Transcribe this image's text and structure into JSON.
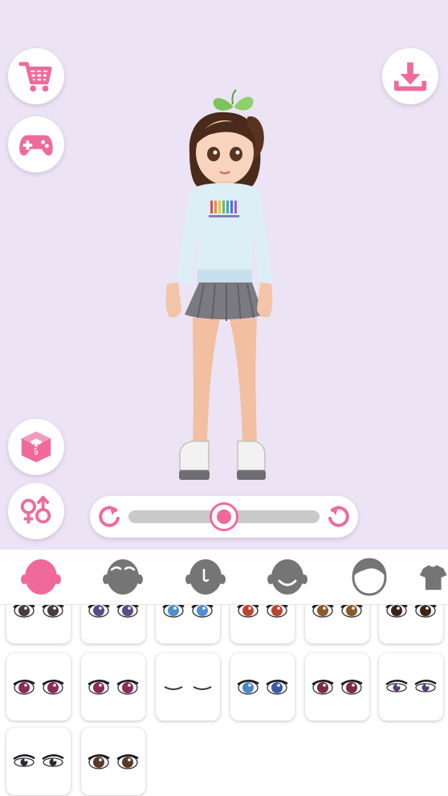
{
  "toolbar": {
    "cart": {
      "icon": "shopping-cart-icon"
    },
    "games": {
      "icon": "gamepad-icon"
    },
    "download": {
      "icon": "download-icon"
    },
    "random_outfit": {
      "icon": "mystery-box-icon"
    },
    "gender_swap": {
      "icon": "gender-swap-icon"
    }
  },
  "rotation": {
    "value_fraction": 0.5,
    "left_icon": "rotate-left-icon",
    "right_icon": "rotate-right-icon"
  },
  "colors": {
    "accent": "#ef6a9a",
    "stage_bg": "#ece4f4",
    "inactive_icon": "#757575"
  },
  "categories": [
    {
      "id": "face",
      "icon": "face-icon",
      "active": true
    },
    {
      "id": "eyebrows",
      "icon": "eyebrows-icon",
      "active": false
    },
    {
      "id": "nose",
      "icon": "nose-icon",
      "active": false
    },
    {
      "id": "mouth",
      "icon": "mouth-icon",
      "active": false
    },
    {
      "id": "hair",
      "icon": "hair-icon",
      "active": false
    },
    {
      "id": "clothing",
      "icon": "shirt-icon",
      "active": false
    }
  ],
  "eye_options": [
    {
      "iris": "#4a3a3a",
      "style": "dark"
    },
    {
      "iris": "#5b4a86",
      "style": "sparkle"
    },
    {
      "iris": "#4d8fd0",
      "style": "blue"
    },
    {
      "iris": "#c0432f",
      "style": "red"
    },
    {
      "iris": "#8a5a2b",
      "style": "amber"
    },
    {
      "iris": "#3a2418",
      "style": "round"
    },
    {
      "iris": "#8d2a5a",
      "style": "magenta"
    },
    {
      "iris": "#8d2a5a",
      "style": "lashes"
    },
    {
      "iris": "#333333",
      "style": "closed"
    },
    {
      "iris": "#4d86c8",
      "style": "heterochromia"
    },
    {
      "iris": "#7a2a4a",
      "style": "bold"
    },
    {
      "iris": "#5a3a7a",
      "style": "narrow"
    },
    {
      "iris": "#2a2a3a",
      "style": "almond"
    },
    {
      "iris": "#5a3a2a",
      "style": "soft"
    }
  ]
}
